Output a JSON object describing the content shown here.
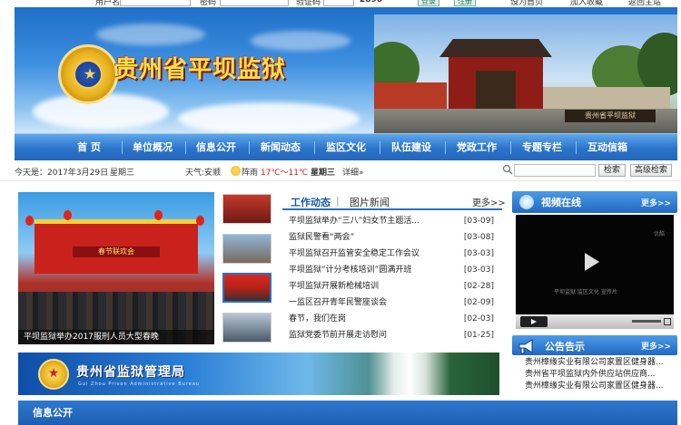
{
  "login": {
    "username_label": "用户名",
    "password_label": "密码",
    "captcha_label": "验证码",
    "captcha_value": "2896",
    "login_button": "登录",
    "register_button": "注册",
    "link_home": "设为首页",
    "link_fav": "加入收藏",
    "link_back": "返回主站"
  },
  "banner": {
    "title": "贵州省平坝监狱",
    "gate_plaque": "贵州省平坝监狱"
  },
  "nav": {
    "items": [
      "首 页",
      "单位概况",
      "信息公开",
      "新闻动态",
      "监区文化",
      "队伍建设",
      "党政工作",
      "专题专栏",
      "互动信箱"
    ]
  },
  "infobar": {
    "date": "今天是：2017年3月29日",
    "weekday": "星期三",
    "weather_label": "天气:安顺",
    "weather": "阵雨",
    "temp": "17℃～11℃",
    "weekday2": "星期三",
    "detail": "详细»",
    "search_button": "检索",
    "advanced_button": "高级检索"
  },
  "slideshow": {
    "stage_title": "春节联欢会",
    "caption": "平坝监狱举办2017服刑人员大型春晚"
  },
  "news": {
    "tab_active": "工作动态",
    "tab_other": "图片新闻",
    "more": "更多>>",
    "items": [
      {
        "title": "平坝监狱举办“三八”妇女节主题活...",
        "date": "[03-09]"
      },
      {
        "title": "监狱民警看“两会”",
        "date": "[03-08]"
      },
      {
        "title": "平坝监狱召开监管安全稳定工作会议",
        "date": "[03-03]"
      },
      {
        "title": "平坝监狱“计分考核培训”圆满开班",
        "date": "[03-03]"
      },
      {
        "title": "平坝监狱开展新枪械培训",
        "date": "[02-28]"
      },
      {
        "title": "一监区召开青年民警座谈会",
        "date": "[02-09]"
      },
      {
        "title": "春节，我们在岗",
        "date": "[02-03]"
      },
      {
        "title": "监狱党委节前开展走访慰问",
        "date": "[01-25]"
      }
    ]
  },
  "video": {
    "title": "视频在线",
    "more": "更多>>",
    "overlay_logo": "优酷",
    "overlay_caption": "平坝监狱 监区文化 宣传片"
  },
  "notices": {
    "title": "公告告示",
    "more": "更多>>",
    "items": [
      "贵州樟缘实业有限公司家置区健身器...",
      "贵州省平坝监狱内外供应站供应商...",
      "贵州樟缘实业有限公司家置区健身器..."
    ]
  },
  "admin_banner": {
    "title": "贵州省监狱管理局",
    "subtitle": "Gui Zhou Prison Administrative Bureau"
  },
  "bottom": {
    "title": "信息公开"
  },
  "colors": {
    "nav_blue": "#2b74cb",
    "title_gold": "#ffe04a",
    "accent_blue": "#1b5aa8"
  }
}
